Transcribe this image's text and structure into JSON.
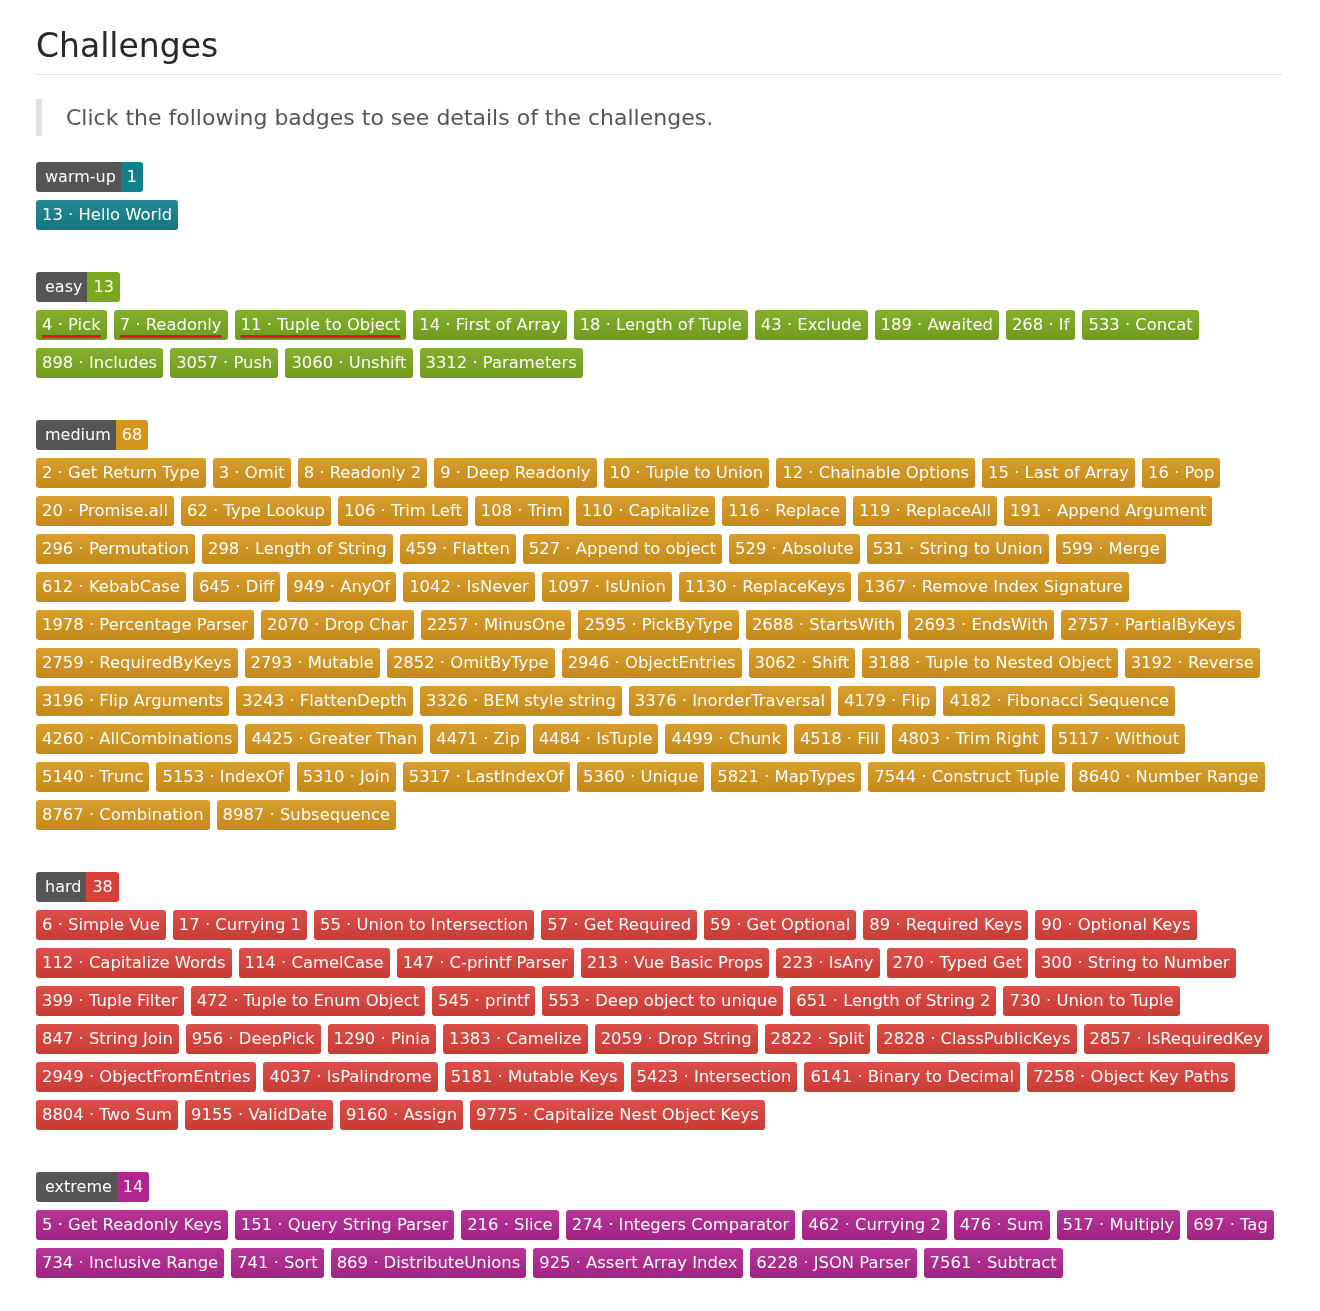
{
  "title": "Challenges",
  "intro": "Click the following badges to see details of the challenges.",
  "groups": [
    {
      "label": "warm-up",
      "count": "1",
      "color": "#12808a",
      "items": [
        {
          "text": "13 · Hello World",
          "struck": false
        }
      ]
    },
    {
      "label": "easy",
      "count": "13",
      "color": "#7aa81e",
      "items": [
        {
          "text": "4 · Pick",
          "struck": true
        },
        {
          "text": "7 · Readonly",
          "struck": true
        },
        {
          "text": "11 · Tuple to Object",
          "struck": true
        },
        {
          "text": "14 · First of Array",
          "struck": false
        },
        {
          "text": "18 · Length of Tuple",
          "struck": false
        },
        {
          "text": "43 · Exclude",
          "struck": false
        },
        {
          "text": "189 · Awaited",
          "struck": false
        },
        {
          "text": "268 · If",
          "struck": false
        },
        {
          "text": "533 · Concat",
          "struck": false
        },
        {
          "text": "898 · Includes",
          "struck": false
        },
        {
          "text": "3057 · Push",
          "struck": false
        },
        {
          "text": "3060 · Unshift",
          "struck": false
        },
        {
          "text": "3312 · Parameters",
          "struck": false
        }
      ]
    },
    {
      "label": "medium",
      "count": "68",
      "color": "#d4951c",
      "items": [
        {
          "text": "2 · Get Return Type",
          "struck": false
        },
        {
          "text": "3 · Omit",
          "struck": false
        },
        {
          "text": "8 · Readonly 2",
          "struck": false
        },
        {
          "text": "9 · Deep Readonly",
          "struck": false
        },
        {
          "text": "10 · Tuple to Union",
          "struck": false
        },
        {
          "text": "12 · Chainable Options",
          "struck": false
        },
        {
          "text": "15 · Last of Array",
          "struck": false
        },
        {
          "text": "16 · Pop",
          "struck": false
        },
        {
          "text": "20 · Promise.all",
          "struck": false
        },
        {
          "text": "62 · Type Lookup",
          "struck": false
        },
        {
          "text": "106 · Trim Left",
          "struck": false
        },
        {
          "text": "108 · Trim",
          "struck": false
        },
        {
          "text": "110 · Capitalize",
          "struck": false
        },
        {
          "text": "116 · Replace",
          "struck": false
        },
        {
          "text": "119 · ReplaceAll",
          "struck": false
        },
        {
          "text": "191 · Append Argument",
          "struck": false
        },
        {
          "text": "296 · Permutation",
          "struck": false
        },
        {
          "text": "298 · Length of String",
          "struck": false
        },
        {
          "text": "459 · Flatten",
          "struck": false
        },
        {
          "text": "527 · Append to object",
          "struck": false
        },
        {
          "text": "529 · Absolute",
          "struck": false
        },
        {
          "text": "531 · String to Union",
          "struck": false
        },
        {
          "text": "599 · Merge",
          "struck": false
        },
        {
          "text": "612 · KebabCase",
          "struck": false
        },
        {
          "text": "645 · Diff",
          "struck": false
        },
        {
          "text": "949 · AnyOf",
          "struck": false
        },
        {
          "text": "1042 · IsNever",
          "struck": false
        },
        {
          "text": "1097 · IsUnion",
          "struck": false
        },
        {
          "text": "1130 · ReplaceKeys",
          "struck": false
        },
        {
          "text": "1367 · Remove Index Signature",
          "struck": false
        },
        {
          "text": "1978 · Percentage Parser",
          "struck": false
        },
        {
          "text": "2070 · Drop Char",
          "struck": false
        },
        {
          "text": "2257 · MinusOne",
          "struck": false
        },
        {
          "text": "2595 · PickByType",
          "struck": false
        },
        {
          "text": "2688 · StartsWith",
          "struck": false
        },
        {
          "text": "2693 · EndsWith",
          "struck": false
        },
        {
          "text": "2757 · PartialByKeys",
          "struck": false
        },
        {
          "text": "2759 · RequiredByKeys",
          "struck": false
        },
        {
          "text": "2793 · Mutable",
          "struck": false
        },
        {
          "text": "2852 · OmitByType",
          "struck": false
        },
        {
          "text": "2946 · ObjectEntries",
          "struck": false
        },
        {
          "text": "3062 · Shift",
          "struck": false
        },
        {
          "text": "3188 · Tuple to Nested Object",
          "struck": false
        },
        {
          "text": "3192 · Reverse",
          "struck": false
        },
        {
          "text": "3196 · Flip Arguments",
          "struck": false
        },
        {
          "text": "3243 · FlattenDepth",
          "struck": false
        },
        {
          "text": "3326 · BEM style string",
          "struck": false
        },
        {
          "text": "3376 · InorderTraversal",
          "struck": false
        },
        {
          "text": "4179 · Flip",
          "struck": false
        },
        {
          "text": "4182 · Fibonacci Sequence",
          "struck": false
        },
        {
          "text": "4260 · AllCombinations",
          "struck": false
        },
        {
          "text": "4425 · Greater Than",
          "struck": false
        },
        {
          "text": "4471 · Zip",
          "struck": false
        },
        {
          "text": "4484 · IsTuple",
          "struck": false
        },
        {
          "text": "4499 · Chunk",
          "struck": false
        },
        {
          "text": "4518 · Fill",
          "struck": false
        },
        {
          "text": "4803 · Trim Right",
          "struck": false
        },
        {
          "text": "5117 · Without",
          "struck": false
        },
        {
          "text": "5140 · Trunc",
          "struck": false
        },
        {
          "text": "5153 · IndexOf",
          "struck": false
        },
        {
          "text": "5310 · Join",
          "struck": false
        },
        {
          "text": "5317 · LastIndexOf",
          "struck": false
        },
        {
          "text": "5360 · Unique",
          "struck": false
        },
        {
          "text": "5821 · MapTypes",
          "struck": false
        },
        {
          "text": "7544 · Construct Tuple",
          "struck": false
        },
        {
          "text": "8640 · Number Range",
          "struck": false
        },
        {
          "text": "8767 · Combination",
          "struck": false
        },
        {
          "text": "8987 · Subsequence",
          "struck": false
        }
      ]
    },
    {
      "label": "hard",
      "count": "38",
      "color": "#d9403a",
      "items": [
        {
          "text": "6 · Simple Vue",
          "struck": false
        },
        {
          "text": "17 · Currying 1",
          "struck": false
        },
        {
          "text": "55 · Union to Intersection",
          "struck": false
        },
        {
          "text": "57 · Get Required",
          "struck": false
        },
        {
          "text": "59 · Get Optional",
          "struck": false
        },
        {
          "text": "89 · Required Keys",
          "struck": false
        },
        {
          "text": "90 · Optional Keys",
          "struck": false
        },
        {
          "text": "112 · Capitalize Words",
          "struck": false
        },
        {
          "text": "114 · CamelCase",
          "struck": false
        },
        {
          "text": "147 · C-printf Parser",
          "struck": false
        },
        {
          "text": "213 · Vue Basic Props",
          "struck": false
        },
        {
          "text": "223 · IsAny",
          "struck": false
        },
        {
          "text": "270 · Typed Get",
          "struck": false
        },
        {
          "text": "300 · String to Number",
          "struck": false
        },
        {
          "text": "399 · Tuple Filter",
          "struck": false
        },
        {
          "text": "472 · Tuple to Enum Object",
          "struck": false
        },
        {
          "text": "545 · printf",
          "struck": false
        },
        {
          "text": "553 · Deep object to unique",
          "struck": false
        },
        {
          "text": "651 · Length of String 2",
          "struck": false
        },
        {
          "text": "730 · Union to Tuple",
          "struck": false
        },
        {
          "text": "847 · String Join",
          "struck": false
        },
        {
          "text": "956 · DeepPick",
          "struck": false
        },
        {
          "text": "1290 · Pinia",
          "struck": false
        },
        {
          "text": "1383 · Camelize",
          "struck": false
        },
        {
          "text": "2059 · Drop String",
          "struck": false
        },
        {
          "text": "2822 · Split",
          "struck": false
        },
        {
          "text": "2828 · ClassPublicKeys",
          "struck": false
        },
        {
          "text": "2857 · IsRequiredKey",
          "struck": false
        },
        {
          "text": "2949 · ObjectFromEntries",
          "struck": false
        },
        {
          "text": "4037 · IsPalindrome",
          "struck": false
        },
        {
          "text": "5181 · Mutable Keys",
          "struck": false
        },
        {
          "text": "5423 · Intersection",
          "struck": false
        },
        {
          "text": "6141 · Binary to Decimal",
          "struck": false
        },
        {
          "text": "7258 · Object Key Paths",
          "struck": false
        },
        {
          "text": "8804 · Two Sum",
          "struck": false
        },
        {
          "text": "9155 · ValidDate",
          "struck": false
        },
        {
          "text": "9160 · Assign",
          "struck": false
        },
        {
          "text": "9775 · Capitalize Nest Object Keys",
          "struck": false
        }
      ]
    },
    {
      "label": "extreme",
      "count": "14",
      "color": "#b0258f",
      "items": [
        {
          "text": "5 · Get Readonly Keys",
          "struck": false
        },
        {
          "text": "151 · Query String Parser",
          "struck": false
        },
        {
          "text": "216 · Slice",
          "struck": false
        },
        {
          "text": "274 · Integers Comparator",
          "struck": false
        },
        {
          "text": "462 · Currying 2",
          "struck": false
        },
        {
          "text": "476 · Sum",
          "struck": false
        },
        {
          "text": "517 · Multiply",
          "struck": false
        },
        {
          "text": "697 · Tag",
          "struck": false
        },
        {
          "text": "734 · Inclusive Range",
          "struck": false
        },
        {
          "text": "741 · Sort",
          "struck": false
        },
        {
          "text": "869 · DistributeUnions",
          "struck": false
        },
        {
          "text": "925 · Assert Array Index",
          "struck": false
        },
        {
          "text": "6228 · JSON Parser",
          "struck": false
        },
        {
          "text": "7561 · Subtract",
          "struck": false
        }
      ]
    }
  ]
}
